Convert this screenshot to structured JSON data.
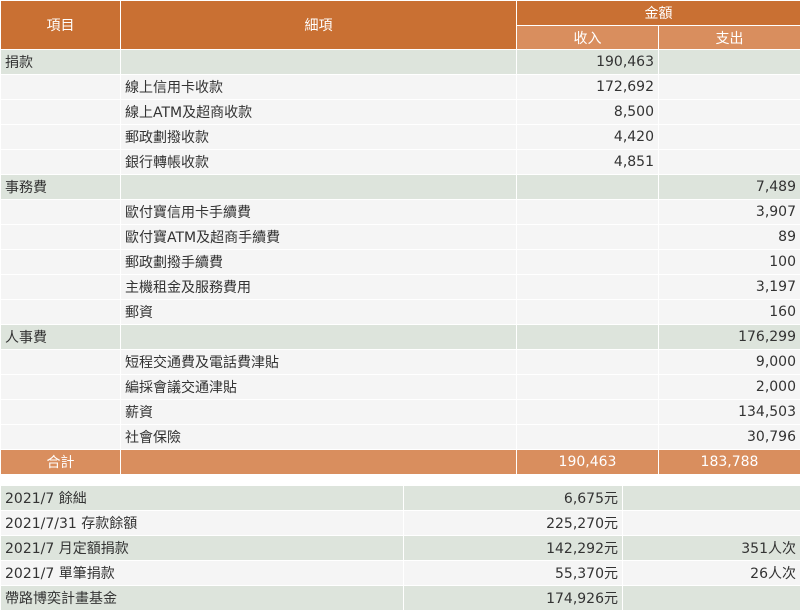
{
  "header": {
    "item": "項目",
    "detail": "細項",
    "amount": "金額",
    "income": "收入",
    "expense": "支出"
  },
  "rows": [
    {
      "type": "cat",
      "item": "捐款",
      "detail": "",
      "income": "190,463",
      "expense": ""
    },
    {
      "type": "itm",
      "item": "",
      "detail": "線上信用卡收款",
      "income": "172,692",
      "expense": ""
    },
    {
      "type": "itm",
      "item": "",
      "detail": "線上ATM及超商收款",
      "income": "8,500",
      "expense": ""
    },
    {
      "type": "itm",
      "item": "",
      "detail": "郵政劃撥收款",
      "income": "4,420",
      "expense": ""
    },
    {
      "type": "itm",
      "item": "",
      "detail": "銀行轉帳收款",
      "income": "4,851",
      "expense": ""
    },
    {
      "type": "cat",
      "item": "事務費",
      "detail": "",
      "income": "",
      "expense": "7,489"
    },
    {
      "type": "itm",
      "item": "",
      "detail": "歐付寶信用卡手續費",
      "income": "",
      "expense": "3,907"
    },
    {
      "type": "itm",
      "item": "",
      "detail": "歐付寶ATM及超商手續費",
      "income": "",
      "expense": "89"
    },
    {
      "type": "itm",
      "item": "",
      "detail": "郵政劃撥手續費",
      "income": "",
      "expense": "100"
    },
    {
      "type": "itm",
      "item": "",
      "detail": "主機租金及服務費用",
      "income": "",
      "expense": "3,197"
    },
    {
      "type": "itm",
      "item": "",
      "detail": "郵資",
      "income": "",
      "expense": "160"
    },
    {
      "type": "cat",
      "item": "人事費",
      "detail": "",
      "income": "",
      "expense": "176,299"
    },
    {
      "type": "itm",
      "item": "",
      "detail": "短程交通費及電話費津貼",
      "income": "",
      "expense": "9,000"
    },
    {
      "type": "itm",
      "item": "",
      "detail": "編採會議交通津貼",
      "income": "",
      "expense": "2,000"
    },
    {
      "type": "itm",
      "item": "",
      "detail": "薪資",
      "income": "",
      "expense": "134,503"
    },
    {
      "type": "itm",
      "item": "",
      "detail": "社會保險",
      "income": "",
      "expense": "30,796"
    }
  ],
  "total": {
    "label": "合計",
    "income": "190,463",
    "expense": "183,788"
  },
  "summary": [
    {
      "label": "2021/7 餘絀",
      "value": "6,675元",
      "extra": ""
    },
    {
      "label": "2021/7/31 存款餘額",
      "value": "225,270元",
      "extra": ""
    },
    {
      "label": "2021/7 月定額捐款",
      "value": "142,292元",
      "extra": "351人次"
    },
    {
      "label": "2021/7 單筆捐款",
      "value": "55,370元",
      "extra": "26人次"
    },
    {
      "label": "帶路博奕計畫基金",
      "value": "174,926元",
      "extra": ""
    }
  ]
}
